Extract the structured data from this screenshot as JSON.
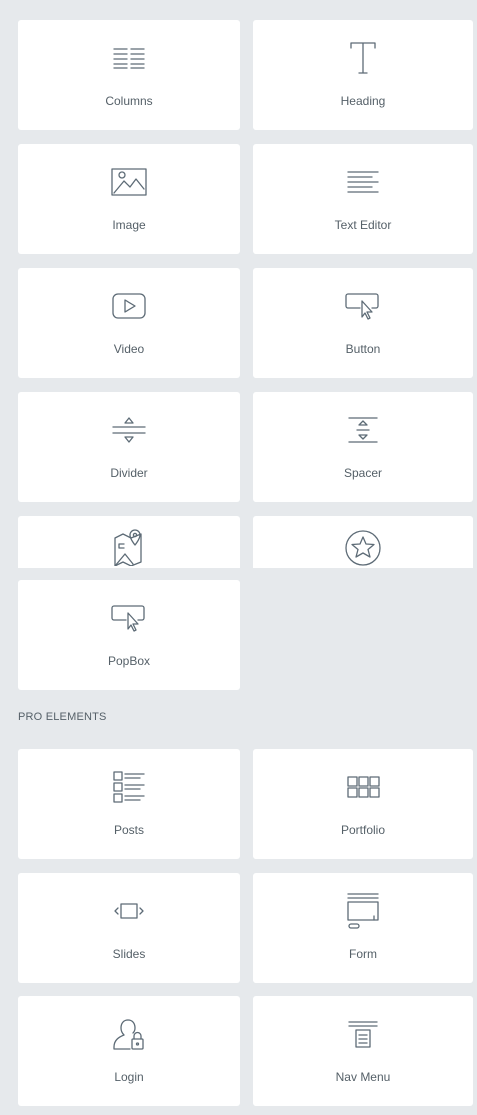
{
  "basic_widgets": [
    {
      "label": "Columns",
      "icon": "columns-icon"
    },
    {
      "label": "Heading",
      "icon": "heading-icon"
    },
    {
      "label": "Image",
      "icon": "image-icon"
    },
    {
      "label": "Text Editor",
      "icon": "text-editor-icon"
    },
    {
      "label": "Video",
      "icon": "video-icon"
    },
    {
      "label": "Button",
      "icon": "button-icon"
    },
    {
      "label": "Divider",
      "icon": "divider-icon"
    },
    {
      "label": "Spacer",
      "icon": "spacer-icon"
    },
    {
      "label": "",
      "icon": "google-maps-icon"
    },
    {
      "label": "",
      "icon": "star-icon"
    },
    {
      "label": "PopBox",
      "icon": "popbox-icon"
    }
  ],
  "pro_section": {
    "title": "PRO ELEMENTS",
    "widgets": [
      {
        "label": "Posts",
        "icon": "posts-icon"
      },
      {
        "label": "Portfolio",
        "icon": "portfolio-icon"
      },
      {
        "label": "Slides",
        "icon": "slides-icon"
      },
      {
        "label": "Form",
        "icon": "form-icon"
      },
      {
        "label": "Login",
        "icon": "login-icon"
      },
      {
        "label": "Nav Menu",
        "icon": "nav-menu-icon"
      }
    ]
  }
}
